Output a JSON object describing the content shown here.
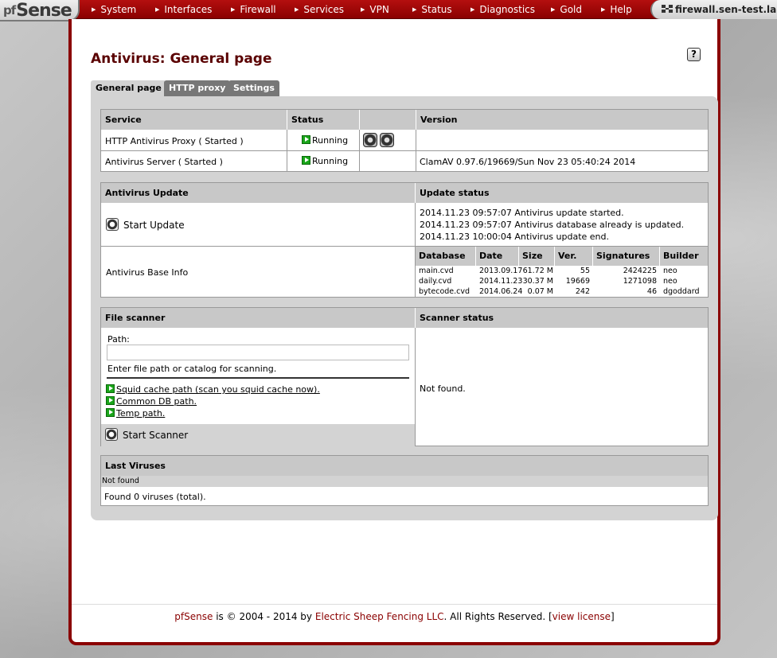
{
  "app": {
    "logo": "Sense",
    "logo_prefix": "pf",
    "hostname": "firewall.sen-test.lan"
  },
  "nav": {
    "items": [
      {
        "label": "System"
      },
      {
        "label": "Interfaces"
      },
      {
        "label": "Firewall"
      },
      {
        "label": "Services"
      },
      {
        "label": "VPN"
      },
      {
        "label": "Status"
      },
      {
        "label": "Diagnostics"
      },
      {
        "label": "Gold"
      },
      {
        "label": "Help"
      }
    ]
  },
  "page": {
    "title": "Antivirus: General page",
    "help_label": "?"
  },
  "tabs": [
    {
      "label": "General page",
      "active": true
    },
    {
      "label": "HTTP proxy",
      "active": false
    },
    {
      "label": "Settings",
      "active": false
    }
  ],
  "services": {
    "headers": {
      "service": "Service",
      "status": "Status",
      "version": "Version"
    },
    "rows": [
      {
        "service": "HTTP Antivirus Proxy ( Started )",
        "status": "Running",
        "version": ""
      },
      {
        "service": "Antivirus Server ( Started )",
        "status": "Running",
        "version": "ClamAV 0.97.6/19669/Sun Nov 23 05:40:24 2014"
      }
    ]
  },
  "update": {
    "header": "Antivirus Update",
    "status_header": "Update status",
    "start_label": "Start Update",
    "log": [
      "2014.11.23 09:57:07 Antivirus update started.",
      "2014.11.23 09:57:07 Antivirus database already is updated.",
      "2014.11.23 10:00:04 Antivirus update end."
    ],
    "base_info_label": "Antivirus Base Info"
  },
  "database": {
    "headers": [
      "Database",
      "Date",
      "Size",
      "Ver.",
      "Signatures",
      "Builder"
    ],
    "rows": [
      [
        "main.cvd",
        "2013.09.17",
        "61.72 M",
        "55",
        "2424225",
        "neo"
      ],
      [
        "daily.cvd",
        "2014.11.23",
        "30.37 M",
        "19669",
        "1271098",
        "neo"
      ],
      [
        "bytecode.cvd",
        "2014.06.24",
        "0.07 M",
        "242",
        "46",
        "dgoddard"
      ]
    ]
  },
  "scanner": {
    "header": "File scanner",
    "status_header": "Scanner status",
    "path_label": "Path:",
    "path_value": "",
    "hint": "Enter file path or catalog for scanning.",
    "links": [
      "Squid cache path (scan you squid cache now).",
      "Common DB path.",
      "Temp path."
    ],
    "start_label": "Start Scanner",
    "status_text": "Not found."
  },
  "viruses": {
    "header": "Last Viruses",
    "not_found": "Not found",
    "summary": "Found 0 viruses (total)."
  },
  "footer": {
    "brand": "pfSense",
    "is": "is ©",
    "years": "2004 - 2014 by",
    "company": "Electric Sheep Fencing LLC",
    "rights": ". All Rights Reserved. [",
    "license": "view license",
    "close": "]"
  }
}
